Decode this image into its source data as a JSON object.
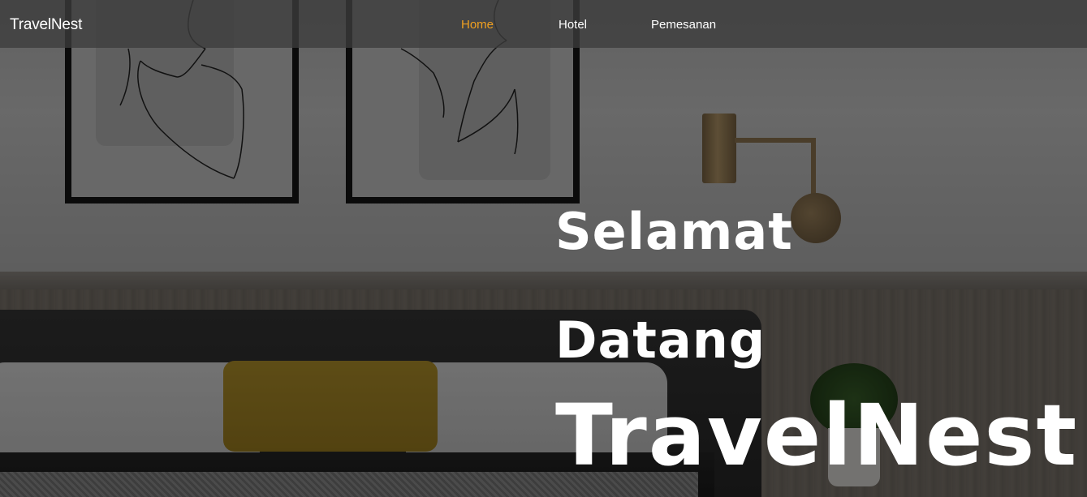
{
  "navbar": {
    "brand": "TravelNest",
    "links": [
      {
        "label": "Home",
        "active": true
      },
      {
        "label": "Hotel",
        "active": false
      },
      {
        "label": "Pemesanan",
        "active": false
      }
    ],
    "active_color": "#f0a020"
  },
  "hero": {
    "line1": "Selamat",
    "line2": "Datang",
    "line3": "TravelNest"
  }
}
